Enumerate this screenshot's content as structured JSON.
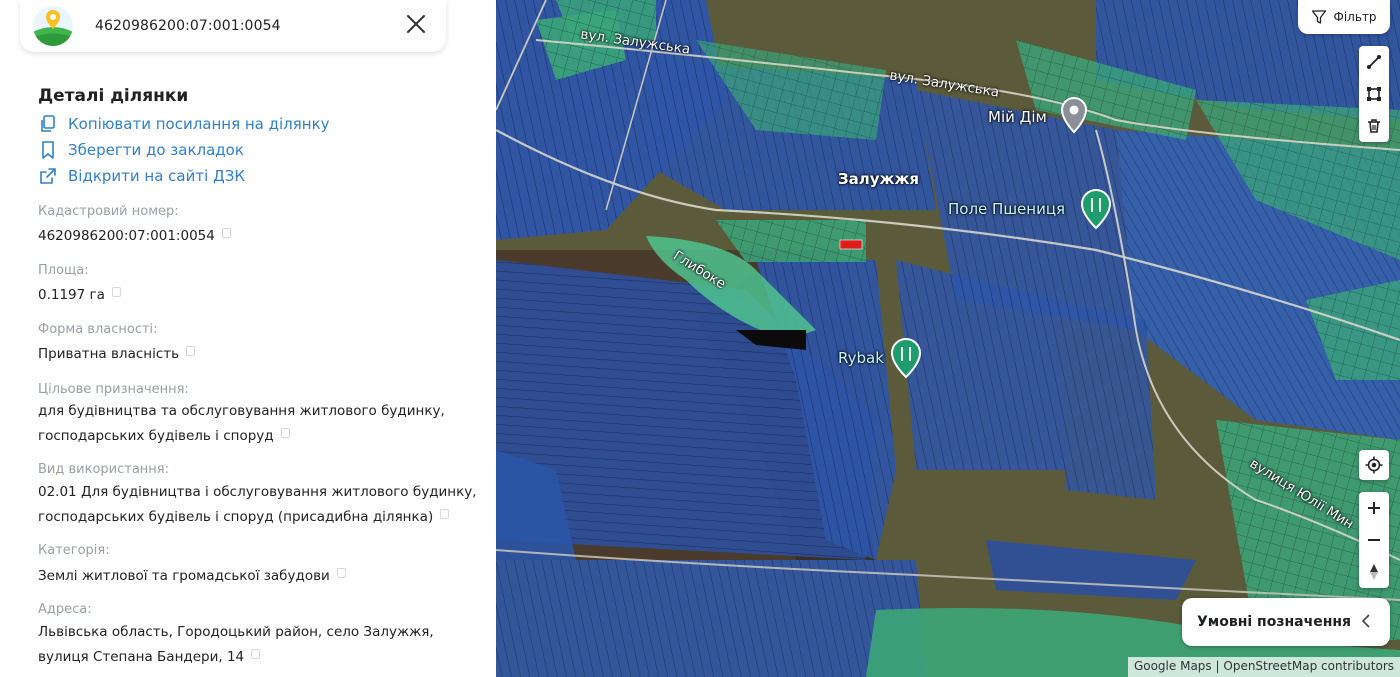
{
  "search": {
    "value": "4620986200:07:001:0054"
  },
  "details": {
    "title": "Деталі ділянки",
    "actions": [
      {
        "label": "Копіювати посилання на ділянку"
      },
      {
        "label": "Зберегти до закладок"
      },
      {
        "label": "Відкрити на сайті ДЗК"
      }
    ],
    "fields": [
      {
        "label": "Кадастровий номер:",
        "value": "4620986200:07:001:0054"
      },
      {
        "label": "Площа:",
        "value": "0.1197 га"
      },
      {
        "label": "Форма власності:",
        "value": "Приватна власність"
      },
      {
        "label": "Цільове призначення:",
        "value_line1": "для будівництва та обслуговування житлового будинку,",
        "value_line2": "господарських будівель і споруд"
      },
      {
        "label": "Вид використання:",
        "value_line1": "02.01 Для будівництва і обслуговування житлового будинку,",
        "value_line2": "господарських будівель і споруд (присадибна ділянка)"
      },
      {
        "label": "Категорія:",
        "value": "Землі житлової та громадської забудови"
      },
      {
        "label": "Адреса:",
        "value_line1": "Львівська область, Городоцький район, село Залужжя,",
        "value_line2": "вулиця Степана Бандери, 14"
      }
    ]
  },
  "map": {
    "labels": {
      "street1": "вул. Залужська",
      "street2": "вул. Залужська",
      "village": "Залужжя",
      "home": "Мій Дім",
      "field": "Поле Пшениця",
      "lake": "Глибоке",
      "rybak": "Rybak",
      "street3": "вулиця Юлії Мин"
    },
    "filter_label": "Фільтр",
    "legend_label": "Умовні позначення",
    "attribution": {
      "google": "Google Maps",
      "separator": "|",
      "osm": "OpenStreetMap contributors"
    },
    "colors": {
      "plot_blue": "#2b4f9e",
      "plot_green": "#3cae7e",
      "selected_plot": "#e01b1b",
      "link": "#2f80d0"
    }
  }
}
